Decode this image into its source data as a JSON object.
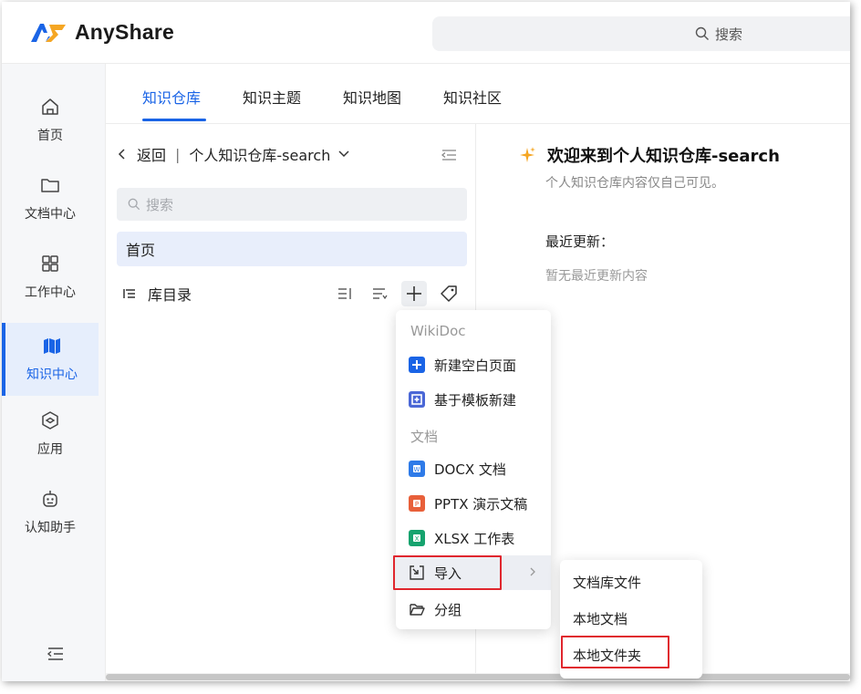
{
  "app": {
    "name": "AnyShare",
    "brand_color": "#1a64e6"
  },
  "header": {
    "search_placeholder": "搜索"
  },
  "leftnav": {
    "items": [
      {
        "label": "首页",
        "icon": "home-icon",
        "active": false
      },
      {
        "label": "文档中心",
        "icon": "folder-icon",
        "active": false
      },
      {
        "label": "工作中心",
        "icon": "grid-icon",
        "active": false
      },
      {
        "label": "知识中心",
        "icon": "map-book-icon",
        "active": true
      },
      {
        "label": "应用",
        "icon": "app-hex-icon",
        "active": false
      },
      {
        "label": "认知助手",
        "icon": "robot-icon",
        "active": false
      }
    ]
  },
  "tabs": [
    "知识仓库",
    "知识主题",
    "知识地图",
    "知识社区"
  ],
  "tree": {
    "back_label": "返回",
    "separator": "|",
    "library_name": "个人知识仓库-search",
    "search_placeholder": "搜索",
    "home_label": "首页",
    "dir_label": "库目录"
  },
  "content": {
    "welcome_title": "欢迎来到个人知识仓库-search",
    "welcome_sub": "个人知识仓库内容仅自己可见。",
    "recent_title": "最近更新：",
    "recent_empty": "暂无最近更新内容"
  },
  "menu": {
    "group_wikidoc": "WikiDoc",
    "new_blank": "新建空白页面",
    "from_template": "基于模板新建",
    "group_doc": "文档",
    "docx": "DOCX 文档",
    "pptx": "PPTX 演示文稿",
    "xlsx": "XLSX 工作表",
    "import": "导入",
    "group": "分组"
  },
  "submenu": {
    "library_file": "文档库文件",
    "local_doc": "本地文档",
    "local_folder": "本地文件夹"
  },
  "colors": {
    "docx": "#2f7be8",
    "pptx": "#e8603a",
    "xlsx": "#16a36e",
    "highlight": "#e0262e"
  }
}
